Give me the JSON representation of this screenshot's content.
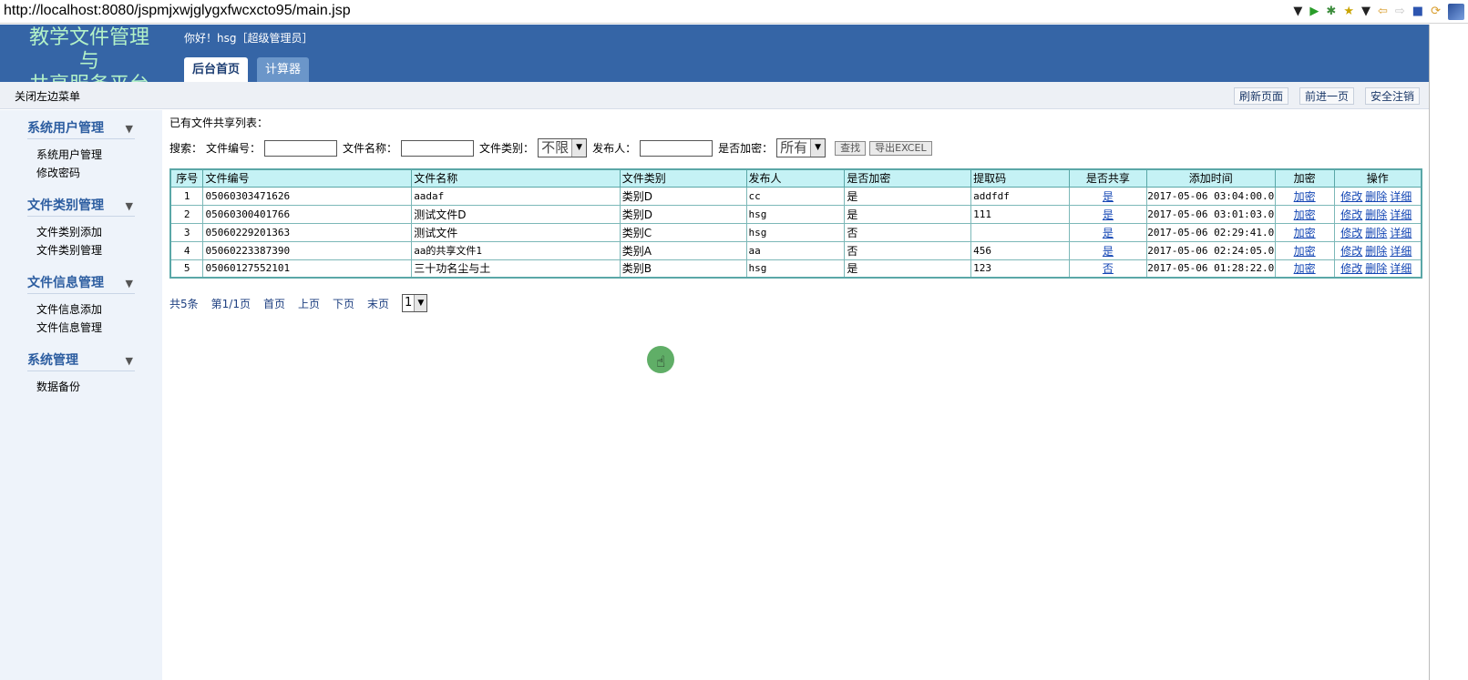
{
  "browser": {
    "url": "http://localhost:8080/jspmjxwjglygxfwcxcto95/main.jsp",
    "toolbar_icons": [
      "dropdown-icon",
      "play-icon",
      "bug-icon",
      "star-icon",
      "back-arrow-icon",
      "forward-arrow-icon",
      "stop-icon",
      "sync-icon",
      "eclipse-logo-icon"
    ]
  },
  "header": {
    "logo_line1": "教学文件管理",
    "logo_line2": "与",
    "logo_line3": "共享服务平台",
    "greeting": "你好！hsg［超级管理员］",
    "tabs": [
      {
        "label": "后台首页",
        "active": true
      },
      {
        "label": "计算器",
        "active": false
      }
    ],
    "bg_color": "#3565a6"
  },
  "subbar": {
    "toggle_label": "关闭左边菜单",
    "refresh_label": "刷新页面",
    "forward_label": "前进一页",
    "logout_label": "安全注销"
  },
  "sidebar": {
    "groups": [
      {
        "title": "系统用户管理",
        "items": [
          "系统用户管理",
          "修改密码"
        ]
      },
      {
        "title": "文件类别管理",
        "items": [
          "文件类别添加",
          "文件类别管理"
        ]
      },
      {
        "title": "文件信息管理",
        "items": [
          "文件信息添加",
          "文件信息管理"
        ]
      },
      {
        "title": "系统管理",
        "items": [
          "数据备份"
        ]
      }
    ]
  },
  "main": {
    "list_title": "已有文件共享列表：",
    "search": {
      "prefix": "搜索：",
      "file_no_label": "文件编号：",
      "file_name_label": "文件名称：",
      "category_label": "文件类别：",
      "category_value": "不限",
      "publisher_label": "发布人：",
      "encrypted_label": "是否加密：",
      "encrypted_value": "所有",
      "search_button": "查找",
      "export_button": "导出EXCEL"
    },
    "table": {
      "headers": [
        "序号",
        "文件编号",
        "文件名称",
        "文件类别",
        "发布人",
        "是否加密",
        "提取码",
        "是否共享",
        "添加时间",
        "加密",
        "操作"
      ],
      "rows": [
        {
          "no": "1",
          "file_no": "05060303471626",
          "name": "aadaf",
          "category": "类别D",
          "publisher": "cc",
          "encrypted": "是",
          "code": "addfdf",
          "shared": "是",
          "time": "2017-05-06 03:04:00.0",
          "encrypt_link": "加密"
        },
        {
          "no": "2",
          "file_no": "05060300401766",
          "name": "测试文件D",
          "category": "类别D",
          "publisher": "hsg",
          "encrypted": "是",
          "code": "111",
          "shared": "是",
          "time": "2017-05-06 03:01:03.0",
          "encrypt_link": "加密"
        },
        {
          "no": "3",
          "file_no": "05060229201363",
          "name": "测试文件",
          "category": "类别C",
          "publisher": "hsg",
          "encrypted": "否",
          "code": "",
          "shared": "是",
          "time": "2017-05-06 02:29:41.0",
          "encrypt_link": "加密"
        },
        {
          "no": "4",
          "file_no": "05060223387390",
          "name": "aa的共享文件1",
          "category": "类别A",
          "publisher": "aa",
          "encrypted": "否",
          "code": "456",
          "shared": "是",
          "time": "2017-05-06 02:24:05.0",
          "encrypt_link": "加密"
        },
        {
          "no": "5",
          "file_no": "05060127552101",
          "name": "三十功名尘与土",
          "category": "类别B",
          "publisher": "hsg",
          "encrypted": "是",
          "code": "123",
          "shared": "否",
          "time": "2017-05-06 01:28:22.0",
          "encrypt_link": "加密"
        }
      ],
      "ops": [
        "修改",
        "删除",
        "详细"
      ]
    },
    "pager": {
      "total": "共5条",
      "page_info": "第1/1页",
      "first": "首页",
      "prev": "上页",
      "next": "下页",
      "last": "末页",
      "page_select": "1"
    }
  }
}
